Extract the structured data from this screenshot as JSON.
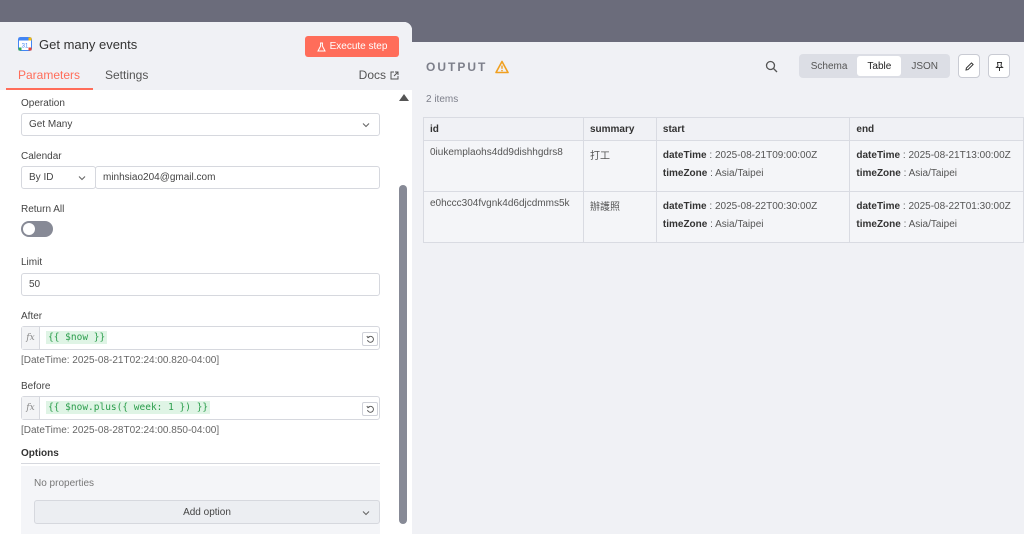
{
  "node": {
    "title": "Get many events",
    "execute_label": "Execute step"
  },
  "tabs": {
    "parameters": "Parameters",
    "settings": "Settings",
    "docs": "Docs"
  },
  "form": {
    "operation_label": "Operation",
    "operation_value": "Get Many",
    "calendar_label": "Calendar",
    "calendar_mode": "By ID",
    "calendar_value": "minhsiao204@gmail.com",
    "return_all_label": "Return All",
    "return_all_on": false,
    "limit_label": "Limit",
    "limit_value": "50",
    "after_label": "After",
    "after_expr": "{{ $now }}",
    "after_hint": "[DateTime: 2025-08-21T02:24:00.820-04:00]",
    "before_label": "Before",
    "before_expr": "{{ $now.plus({ week: 1 }) }}",
    "before_hint": "[DateTime: 2025-08-28T02:24:00.850-04:00]",
    "options_label": "Options",
    "no_properties": "No properties",
    "add_option": "Add option"
  },
  "output": {
    "title": "OUTPUT",
    "items_count": "2 items",
    "views": [
      "Schema",
      "Table",
      "JSON"
    ],
    "active_view": "Table",
    "columns": [
      "id",
      "summary",
      "start",
      "end"
    ],
    "rows": [
      {
        "id": "0iukemplaohs4dd9dishhgdrs8",
        "summary": "打工",
        "start_dateTime": "2025-08-21T09:00:00Z",
        "start_timeZone": "Asia/Taipei",
        "end_dateTime": "2025-08-21T13:00:00Z",
        "end_timeZone": "Asia/Taipei"
      },
      {
        "id": "e0hccc304fvgnk4d6djcdmms5k",
        "summary": "辦護照",
        "start_dateTime": "2025-08-22T00:30:00Z",
        "start_timeZone": "Asia/Taipei",
        "end_dateTime": "2025-08-22T01:30:00Z",
        "end_timeZone": "Asia/Taipei"
      }
    ],
    "key_dateTime": "dateTime",
    "key_timeZone": "timeZone",
    "separator": " : "
  },
  "colors": {
    "accent": "#ff6d5a",
    "warning": "#f0a020",
    "expression_green": "#2a9d4b"
  }
}
